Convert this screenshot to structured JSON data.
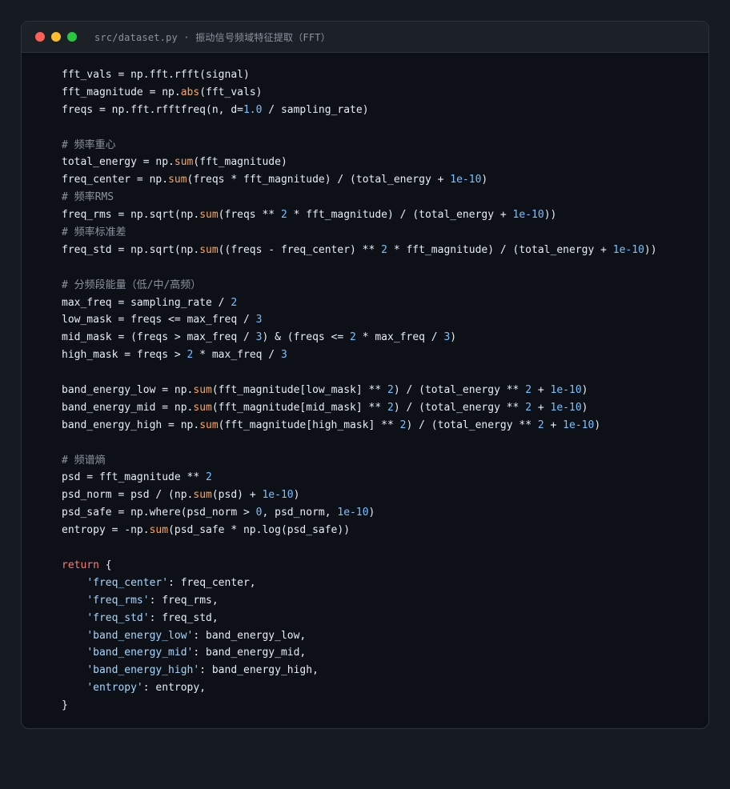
{
  "window": {
    "title": "src/dataset.py · 振动信号频域特征提取（FFT）",
    "dots": {
      "red": "#ff5f57",
      "yellow": "#febc2e",
      "green": "#28c840"
    }
  },
  "colors": {
    "background": "#161b22",
    "editor": "#0d1117",
    "text": "#e6edf3",
    "comment": "#8b949e",
    "function": "#ffa657",
    "number": "#79c0ff",
    "string": "#a5d6ff",
    "keyword": "#ff7b72"
  },
  "code_lines": [
    [
      {
        "t": "fft_vals = np.fft.rfft(signal)"
      }
    ],
    [
      {
        "t": "fft_magnitude = np."
      },
      {
        "t": "abs",
        "c": "func"
      },
      {
        "t": "(fft_vals)"
      }
    ],
    [
      {
        "t": "freqs = np.fft.rfftfreq(n, d="
      },
      {
        "t": "1.0",
        "c": "num"
      },
      {
        "t": " / sampling_rate)"
      }
    ],
    [],
    [
      {
        "t": "# 频率重心",
        "c": "comment"
      }
    ],
    [
      {
        "t": "total_energy = np."
      },
      {
        "t": "sum",
        "c": "func"
      },
      {
        "t": "(fft_magnitude)"
      }
    ],
    [
      {
        "t": "freq_center = np."
      },
      {
        "t": "sum",
        "c": "func"
      },
      {
        "t": "(freqs * fft_magnitude) / (total_energy + "
      },
      {
        "t": "1e-10",
        "c": "num"
      },
      {
        "t": ")"
      }
    ],
    [
      {
        "t": "# 频率RMS",
        "c": "comment"
      }
    ],
    [
      {
        "t": "freq_rms = np.sqrt(np."
      },
      {
        "t": "sum",
        "c": "func"
      },
      {
        "t": "(freqs ** "
      },
      {
        "t": "2",
        "c": "num"
      },
      {
        "t": " * fft_magnitude) / (total_energy + "
      },
      {
        "t": "1e-10",
        "c": "num"
      },
      {
        "t": "))"
      }
    ],
    [
      {
        "t": "# 频率标准差",
        "c": "comment"
      }
    ],
    [
      {
        "t": "freq_std = np.sqrt(np."
      },
      {
        "t": "sum",
        "c": "func"
      },
      {
        "t": "((freqs - freq_center) ** "
      },
      {
        "t": "2",
        "c": "num"
      },
      {
        "t": " * fft_magnitude) / (total_energy + "
      },
      {
        "t": "1e-10",
        "c": "num"
      },
      {
        "t": "))"
      }
    ],
    [],
    [
      {
        "t": "# 分频段能量（低/中/高频）",
        "c": "comment"
      }
    ],
    [
      {
        "t": "max_freq = sampling_rate / "
      },
      {
        "t": "2",
        "c": "num"
      }
    ],
    [
      {
        "t": "low_mask = freqs <= max_freq / "
      },
      {
        "t": "3",
        "c": "num"
      }
    ],
    [
      {
        "t": "mid_mask = (freqs > max_freq / "
      },
      {
        "t": "3",
        "c": "num"
      },
      {
        "t": ") & (freqs <= "
      },
      {
        "t": "2",
        "c": "num"
      },
      {
        "t": " * max_freq / "
      },
      {
        "t": "3",
        "c": "num"
      },
      {
        "t": ")"
      }
    ],
    [
      {
        "t": "high_mask = freqs > "
      },
      {
        "t": "2",
        "c": "num"
      },
      {
        "t": " * max_freq / "
      },
      {
        "t": "3",
        "c": "num"
      }
    ],
    [],
    [
      {
        "t": "band_energy_low = np."
      },
      {
        "t": "sum",
        "c": "func"
      },
      {
        "t": "(fft_magnitude[low_mask] ** "
      },
      {
        "t": "2",
        "c": "num"
      },
      {
        "t": ") / (total_energy ** "
      },
      {
        "t": "2",
        "c": "num"
      },
      {
        "t": " + "
      },
      {
        "t": "1e-10",
        "c": "num"
      },
      {
        "t": ")"
      }
    ],
    [
      {
        "t": "band_energy_mid = np."
      },
      {
        "t": "sum",
        "c": "func"
      },
      {
        "t": "(fft_magnitude[mid_mask] ** "
      },
      {
        "t": "2",
        "c": "num"
      },
      {
        "t": ") / (total_energy ** "
      },
      {
        "t": "2",
        "c": "num"
      },
      {
        "t": " + "
      },
      {
        "t": "1e-10",
        "c": "num"
      },
      {
        "t": ")"
      }
    ],
    [
      {
        "t": "band_energy_high = np."
      },
      {
        "t": "sum",
        "c": "func"
      },
      {
        "t": "(fft_magnitude[high_mask] ** "
      },
      {
        "t": "2",
        "c": "num"
      },
      {
        "t": ") / (total_energy ** "
      },
      {
        "t": "2",
        "c": "num"
      },
      {
        "t": " + "
      },
      {
        "t": "1e-10",
        "c": "num"
      },
      {
        "t": ")"
      }
    ],
    [],
    [
      {
        "t": "# 频谱熵",
        "c": "comment"
      }
    ],
    [
      {
        "t": "psd = fft_magnitude ** "
      },
      {
        "t": "2",
        "c": "num"
      }
    ],
    [
      {
        "t": "psd_norm = psd / (np."
      },
      {
        "t": "sum",
        "c": "func"
      },
      {
        "t": "(psd) + "
      },
      {
        "t": "1e-10",
        "c": "num"
      },
      {
        "t": ")"
      }
    ],
    [
      {
        "t": "psd_safe = np.where(psd_norm > "
      },
      {
        "t": "0",
        "c": "num"
      },
      {
        "t": ", psd_norm, "
      },
      {
        "t": "1e-10",
        "c": "num"
      },
      {
        "t": ")"
      }
    ],
    [
      {
        "t": "entropy = -np."
      },
      {
        "t": "sum",
        "c": "func"
      },
      {
        "t": "(psd_safe * np.log(psd_safe))"
      }
    ],
    [],
    [
      {
        "t": "return",
        "c": "kw"
      },
      {
        "t": " {"
      }
    ],
    [
      {
        "t": "    "
      },
      {
        "t": "'freq_center'",
        "c": "str"
      },
      {
        "t": ": freq_center,"
      }
    ],
    [
      {
        "t": "    "
      },
      {
        "t": "'freq_rms'",
        "c": "str"
      },
      {
        "t": ": freq_rms,"
      }
    ],
    [
      {
        "t": "    "
      },
      {
        "t": "'freq_std'",
        "c": "str"
      },
      {
        "t": ": freq_std,"
      }
    ],
    [
      {
        "t": "    "
      },
      {
        "t": "'band_energy_low'",
        "c": "str"
      },
      {
        "t": ": band_energy_low,"
      }
    ],
    [
      {
        "t": "    "
      },
      {
        "t": "'band_energy_mid'",
        "c": "str"
      },
      {
        "t": ": band_energy_mid,"
      }
    ],
    [
      {
        "t": "    "
      },
      {
        "t": "'band_energy_high'",
        "c": "str"
      },
      {
        "t": ": band_energy_high,"
      }
    ],
    [
      {
        "t": "    "
      },
      {
        "t": "'entropy'",
        "c": "str"
      },
      {
        "t": ": entropy,"
      }
    ],
    [
      {
        "t": "}"
      }
    ]
  ]
}
